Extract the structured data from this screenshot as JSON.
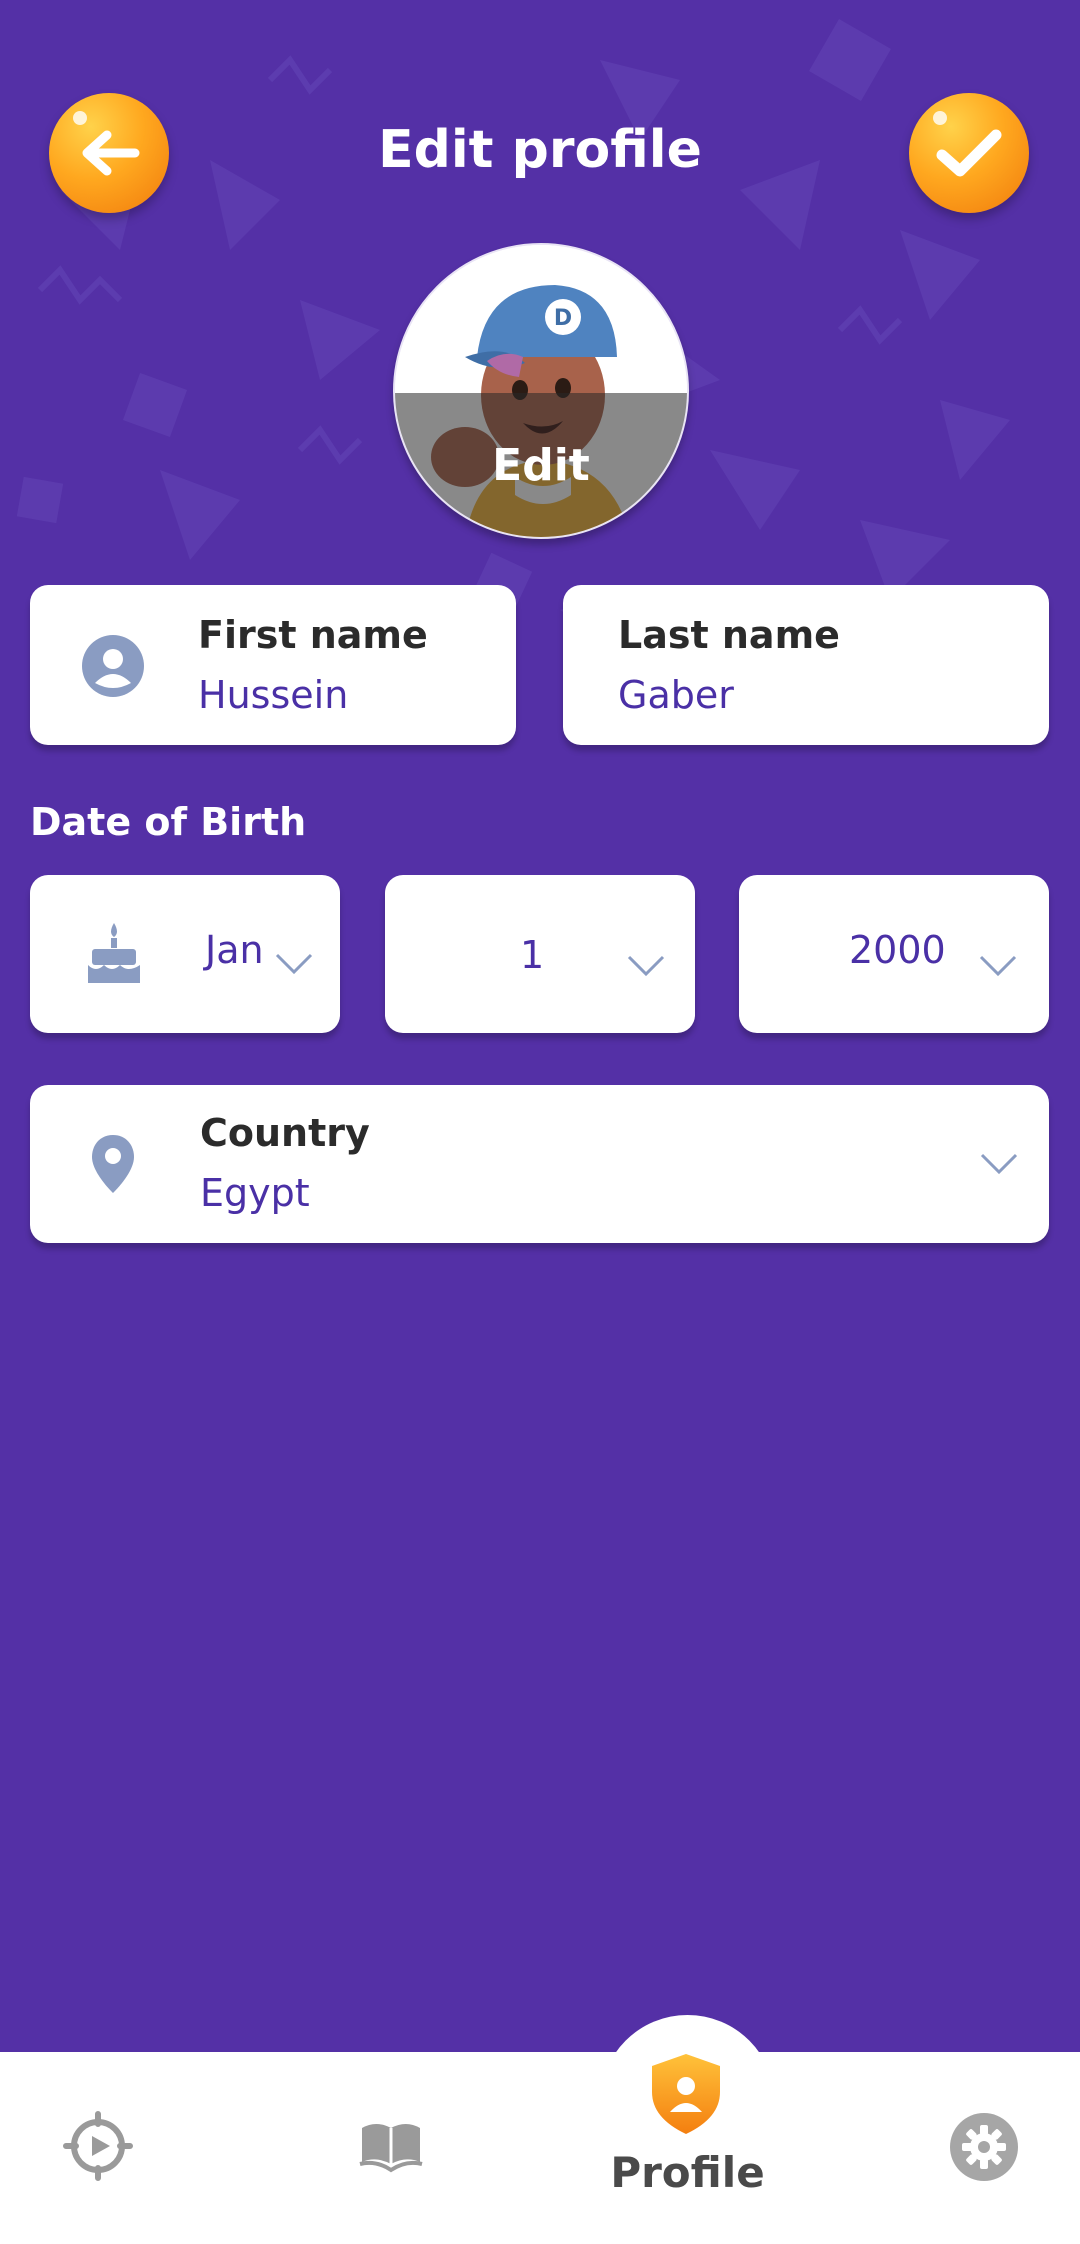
{
  "header": {
    "title": "Edit profile"
  },
  "avatar": {
    "edit_label": "Edit"
  },
  "form": {
    "first_name": {
      "label": "First name",
      "value": "Hussein"
    },
    "last_name": {
      "label": "Last name",
      "value": "Gaber"
    },
    "date_of_birth": {
      "label": "Date of Birth",
      "month": "Jan",
      "day": "1",
      "year": "2000"
    },
    "country": {
      "label": "Country",
      "value": "Egypt"
    }
  },
  "bottom_nav": {
    "items": [
      {
        "icon": "explore-play-icon"
      },
      {
        "icon": "book-icon"
      },
      {
        "icon": "profile-shield-icon",
        "label": "Profile",
        "active": true
      },
      {
        "icon": "gear-icon"
      }
    ]
  },
  "colors": {
    "background": "#5430a6",
    "accent": "#f7941d",
    "value_text": "#4a30a6",
    "icon_gray_blue": "#8a9cc2"
  }
}
